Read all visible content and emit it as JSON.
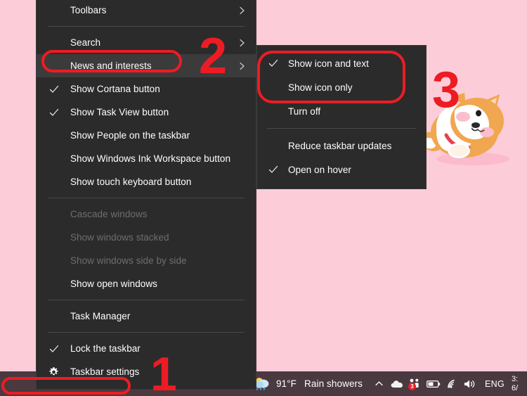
{
  "desktop": {
    "wallpaper_color": "#fcccd8",
    "wallpaper_subject": "shiba-inu-dog-illustration"
  },
  "context_menu": {
    "name": "Taskbar context menu",
    "background_color": "#2b2b2b",
    "items": [
      {
        "id": "toolbars",
        "label": "Toolbars",
        "checked": false,
        "disabled": false,
        "submenu": true,
        "highlight": false
      },
      {
        "id": "separator-1",
        "type": "separator"
      },
      {
        "id": "search",
        "label": "Search",
        "checked": false,
        "disabled": false,
        "submenu": true,
        "highlight": false
      },
      {
        "id": "news-and-interests",
        "label": "News and interests",
        "checked": false,
        "disabled": false,
        "submenu": true,
        "highlight": true
      },
      {
        "id": "show-cortana-button",
        "label": "Show Cortana button",
        "checked": true,
        "disabled": false,
        "submenu": false,
        "highlight": false
      },
      {
        "id": "show-task-view-button",
        "label": "Show Task View button",
        "checked": true,
        "disabled": false,
        "submenu": false,
        "highlight": false
      },
      {
        "id": "show-people-on-the-taskbar",
        "label": "Show People on the taskbar",
        "checked": false,
        "disabled": false,
        "submenu": false,
        "highlight": false
      },
      {
        "id": "show-windows-ink-workspace-button",
        "label": "Show Windows Ink Workspace button",
        "checked": false,
        "disabled": false,
        "submenu": false,
        "highlight": false
      },
      {
        "id": "show-touch-keyboard-button",
        "label": "Show touch keyboard button",
        "checked": false,
        "disabled": false,
        "submenu": false,
        "highlight": false
      },
      {
        "id": "separator-2",
        "type": "separator"
      },
      {
        "id": "cascade-windows",
        "label": "Cascade windows",
        "checked": false,
        "disabled": true,
        "submenu": false,
        "highlight": false
      },
      {
        "id": "show-windows-stacked",
        "label": "Show windows stacked",
        "checked": false,
        "disabled": true,
        "submenu": false,
        "highlight": false
      },
      {
        "id": "show-windows-side-by-side",
        "label": "Show windows side by side",
        "checked": false,
        "disabled": true,
        "submenu": false,
        "highlight": false
      },
      {
        "id": "show-open-windows",
        "label": "Show open windows",
        "checked": false,
        "disabled": false,
        "submenu": false,
        "highlight": false
      },
      {
        "id": "separator-3",
        "type": "separator"
      },
      {
        "id": "task-manager",
        "label": "Task Manager",
        "checked": false,
        "disabled": false,
        "submenu": false,
        "highlight": false
      },
      {
        "id": "separator-4",
        "type": "separator"
      },
      {
        "id": "lock-the-taskbar",
        "label": "Lock the taskbar",
        "checked": true,
        "disabled": false,
        "submenu": false,
        "highlight": false
      },
      {
        "id": "taskbar-settings",
        "label": "Taskbar settings",
        "checked": false,
        "gear": true,
        "disabled": false,
        "submenu": false,
        "highlight": false
      }
    ]
  },
  "submenu": {
    "name": "News and interests submenu",
    "items": [
      {
        "id": "show-icon-and-text",
        "label": "Show icon and text",
        "checked": true,
        "disabled": false
      },
      {
        "id": "show-icon-only",
        "label": "Show icon only",
        "checked": false,
        "disabled": false
      },
      {
        "id": "turn-off",
        "label": "Turn off",
        "checked": false,
        "disabled": false
      },
      {
        "id": "separator-1",
        "type": "separator"
      },
      {
        "id": "reduce-taskbar-updates",
        "label": "Reduce taskbar updates",
        "checked": false,
        "disabled": false
      },
      {
        "id": "open-on-hover",
        "label": "Open on hover",
        "checked": true,
        "disabled": false
      }
    ]
  },
  "taskbar": {
    "background_color": "#4b3940",
    "weather": {
      "temperature": "91°F",
      "condition": "Rain showers"
    },
    "tray": {
      "show_hidden_label": "^",
      "onedrive": "onedrive-cloud-icon",
      "teams_badge": "3",
      "battery": "battery-icon",
      "network": "wifi-icon",
      "volume": "speaker-icon",
      "language": "ENG"
    },
    "clock": {
      "time": "3:",
      "date": "6/"
    }
  },
  "annotations": {
    "color": "#ed1c24",
    "markers": [
      {
        "id": "marker-1",
        "label": "1"
      },
      {
        "id": "marker-2",
        "label": "2"
      },
      {
        "id": "marker-3",
        "label": "3"
      }
    ],
    "boxes": [
      {
        "id": "box-news-and-interests",
        "target": "News and interests"
      },
      {
        "id": "box-show-icon-options",
        "target": "Show icon and text / Show icon only"
      },
      {
        "id": "box-taskbar-empty-area",
        "target": "taskbar empty area"
      }
    ]
  }
}
